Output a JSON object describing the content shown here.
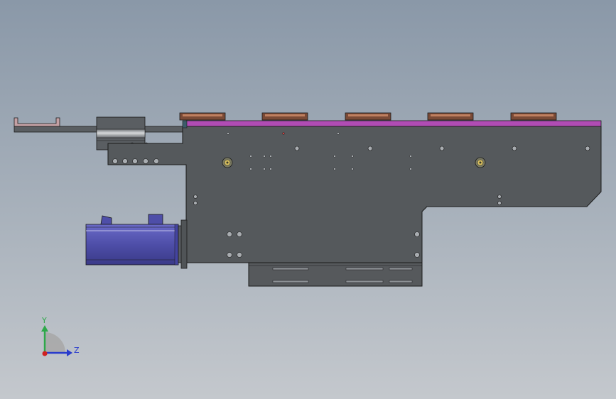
{
  "viewport": {
    "background_top": "#8a98a8",
    "background_bottom": "#c4c8cd"
  },
  "model": {
    "plate_color": "#55595c",
    "rail_color": "#b04cb4",
    "motor_color": "#4e4ea8",
    "block_color": "#7a4a36"
  },
  "triad": {
    "y_label": "Y",
    "z_label": "Z",
    "y_color": "#2ea84a",
    "z_color": "#2a3ccc",
    "x_color": "#d02020"
  }
}
